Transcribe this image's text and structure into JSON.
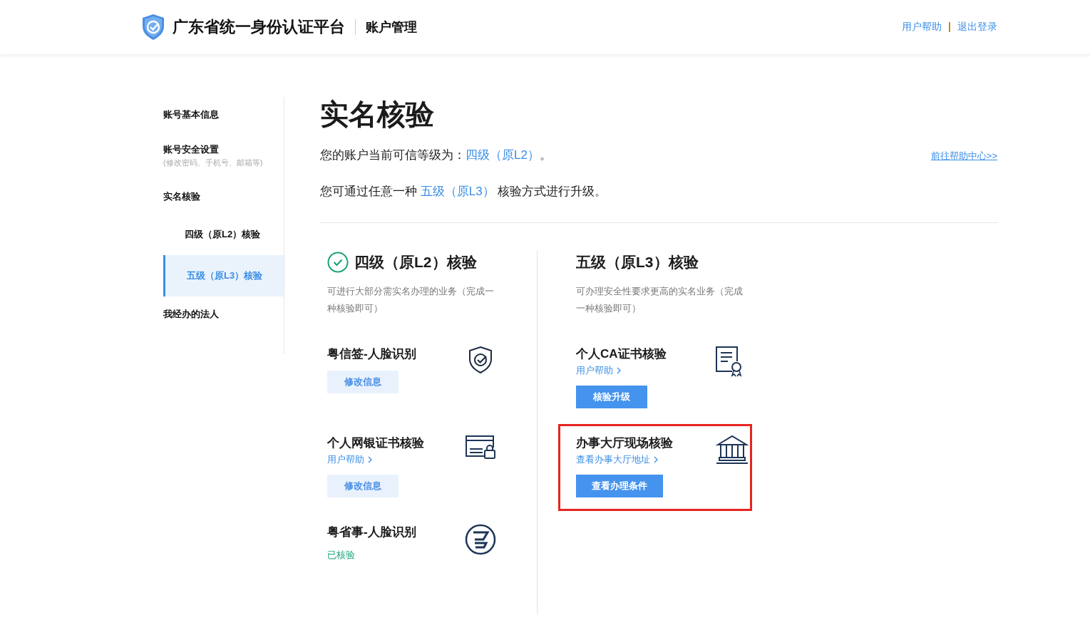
{
  "header": {
    "title": "广东省统一身份认证平台",
    "subtitle": "账户管理",
    "links": [
      "用户帮助",
      "退出登录"
    ]
  },
  "sidebar": {
    "items": [
      {
        "label": "账号基本信息",
        "selected": false
      },
      {
        "label": "账号安全设置",
        "note": "(修改密码、手机号、邮箱等)",
        "selected": false
      },
      {
        "label": "实名核验",
        "selected": false,
        "children": [
          {
            "label": "四级（原L2）核验",
            "selected": false
          },
          {
            "label": "五级（原L3）核验",
            "selected": true
          }
        ]
      },
      {
        "label": "我经办的法人",
        "selected": false
      }
    ]
  },
  "main": {
    "title": "实名核验",
    "level_line": {
      "before": "您的账户当前可信等级为：",
      "level": "四级（原L2）",
      "after": "。"
    },
    "help_link": "前往帮助中心>>",
    "upgrade_line": {
      "before": "您可通过任意一种",
      "level": "五级（原L3）",
      "after": "核验方式进行升级。"
    },
    "columns": [
      {
        "title": "四级（原L2）核验",
        "achieved": true,
        "description": "可进行大部分需实名办理的业务（完成一种核验即可）",
        "methods": [
          {
            "title": "粤信签-人脸识别",
            "button": {
              "label": "修改信息",
              "kind": "secondary"
            },
            "highlighted": false
          },
          {
            "title": "个人网银证书核验",
            "link": "用户帮助",
            "button": {
              "label": "修改信息",
              "kind": "secondary"
            },
            "highlighted": false
          },
          {
            "title": "粤省事-人脸识别",
            "status": "已核验",
            "highlighted": false
          }
        ]
      },
      {
        "title": "五级（原L3）核验",
        "achieved": false,
        "description": "可办理安全性要求更高的实名业务（完成一种核验即可）",
        "methods": [
          {
            "title": "个人CA证书核验",
            "link": "用户帮助",
            "button": {
              "label": "核验升级",
              "kind": "primary"
            },
            "highlighted": false
          },
          {
            "title": "办事大厅现场核验",
            "link": "查看办事大厅地址",
            "button": {
              "label": "查看办理条件",
              "kind": "primary"
            },
            "highlighted": true
          }
        ]
      }
    ]
  }
}
